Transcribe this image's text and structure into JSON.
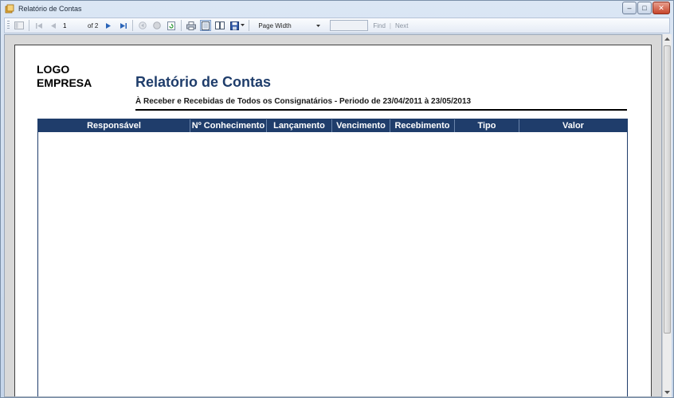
{
  "window": {
    "title": "Relatório de Contas",
    "controls": {
      "minimize": "–",
      "maximize": "□",
      "close": "✕"
    }
  },
  "toolbar": {
    "page_current": "1",
    "page_of": "of 2",
    "zoom": "Page Width",
    "find_label": "Find",
    "find_separator": "|",
    "next_label": "Next"
  },
  "report": {
    "logo_line1": "LOGO",
    "logo_line2": "EMPRESA",
    "title": "Relatório de Contas",
    "subtitle": "À Receber e Recebidas de Todos os Consignatários - Periodo de 23/04/2011 à 23/05/2013",
    "columns": [
      "Responsável",
      "Nº Conhecimento",
      "Lançamento",
      "Vencimento",
      "Recebimento",
      "Tipo",
      "Valor"
    ]
  },
  "colors": {
    "header_bg": "#1f3d6b",
    "title_color": "#1f3d6b"
  }
}
